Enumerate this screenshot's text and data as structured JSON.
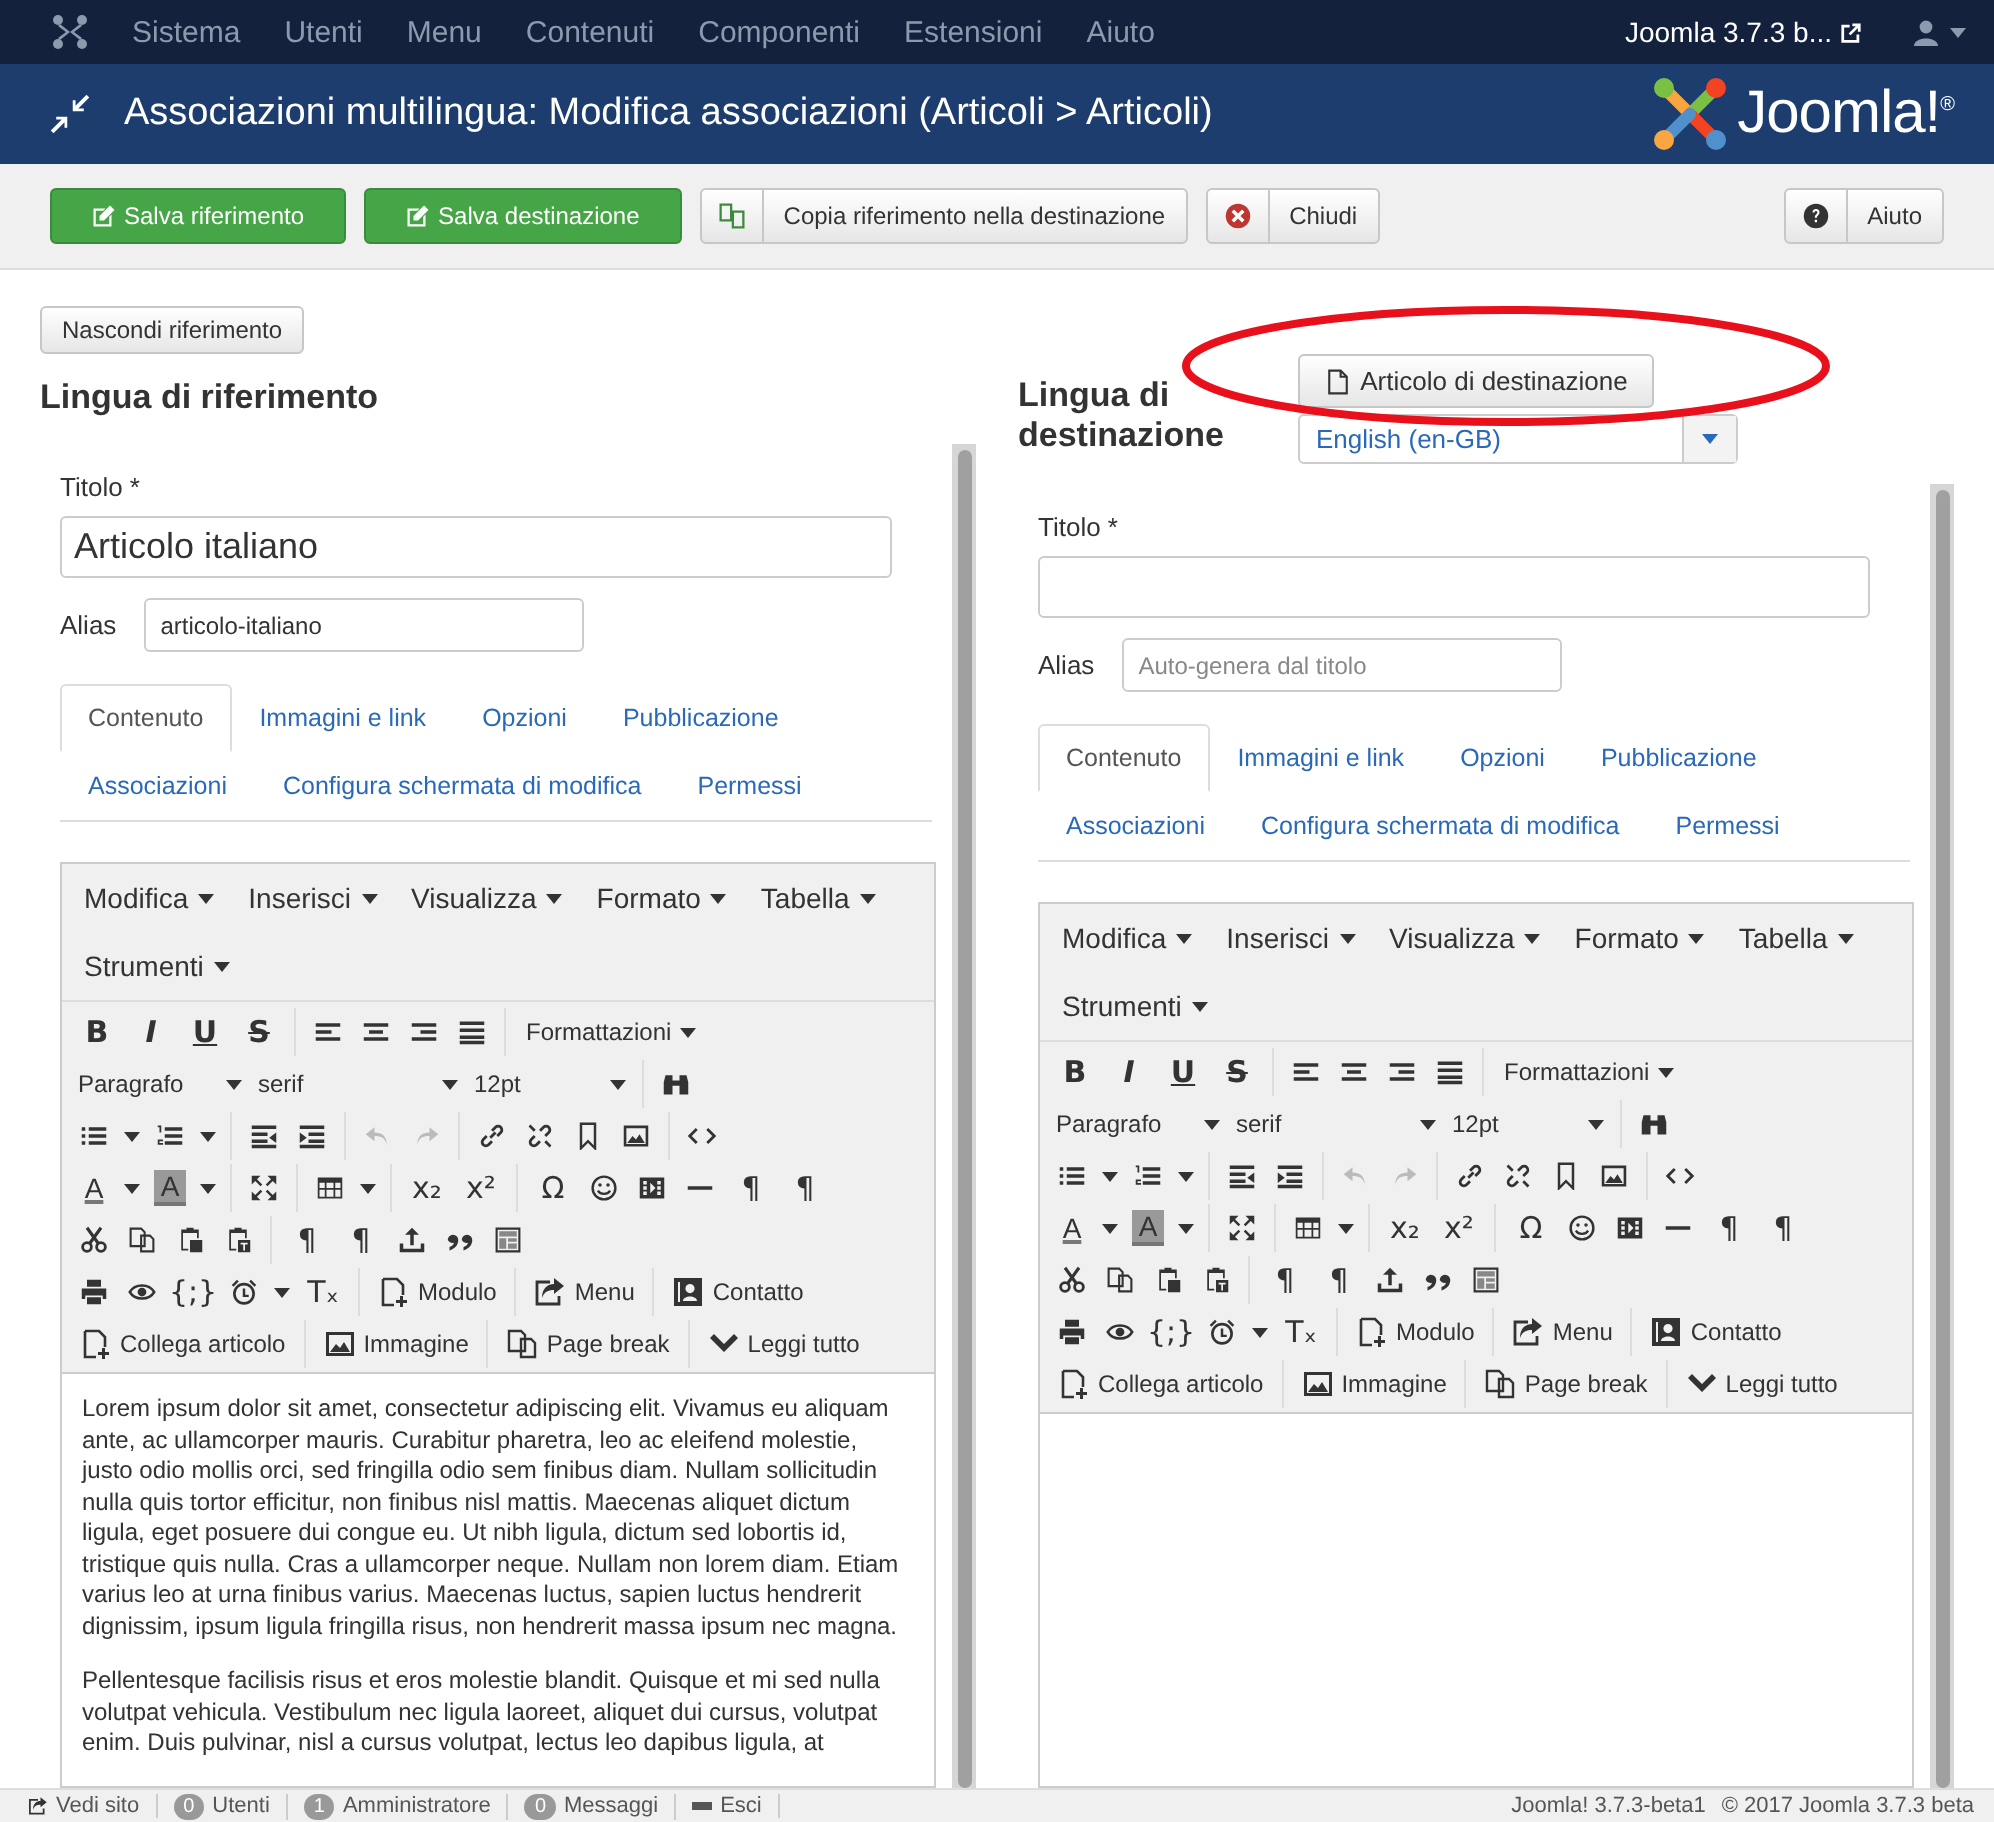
{
  "navbar": {
    "items": [
      "Sistema",
      "Utenti",
      "Menu",
      "Contenuti",
      "Componenti",
      "Estensioni",
      "Aiuto"
    ],
    "site_link": "Joomla 3.7.3 b..."
  },
  "header": {
    "title": "Associazioni multilingua: Modifica associazioni (Articoli > Articoli)",
    "logo_text": "Joomla!$^{®}$"
  },
  "toolbar": {
    "buttons": [
      {
        "label": "Salva riferimento",
        "kind": "success"
      },
      {
        "label": "Salva destinazione",
        "kind": "success"
      },
      {
        "label": "Copia riferimento nella destinazione",
        "kind": "default"
      },
      {
        "label": "Chiudi",
        "kind": "default"
      }
    ],
    "help": "Aiuto"
  },
  "hide_button": "Nascondi riferimento",
  "reference": {
    "heading": "Lingua di riferimento",
    "title_label": "Titolo *",
    "title_value": "Articolo italiano",
    "alias_label": "Alias",
    "alias_value": "articolo-italiano",
    "tabs": [
      {
        "label": "Contenuto",
        "selected": true
      },
      {
        "label": "Immagini e link",
        "selected": false
      },
      {
        "label": "Opzioni",
        "selected": false
      },
      {
        "label": "Pubblicazione",
        "selected": false
      },
      {
        "label": "Associazioni",
        "selected": false
      },
      {
        "label": "Configura schermata di modifica",
        "selected": false
      },
      {
        "label": "Permessi",
        "selected": false
      }
    ],
    "editor": {
      "menus": [
        "Modifica",
        "Inserisci",
        "Visualizza",
        "Formato",
        "Tabella",
        "Strumenti"
      ],
      "rows": [
        {
          "items": [
            {
              "kind": "glyph",
              "text": "B"
            },
            {
              "kind": "glyph",
              "text": "I"
            },
            {
              "kind": "glyph",
              "text": "U"
            },
            {
              "kind": "glyph",
              "text": "S"
            },
            {
              "kind": "sep"
            },
            {
              "kind": "icon"
            },
            {
              "kind": "icon"
            },
            {
              "kind": "icon"
            },
            {
              "kind": "icon"
            },
            {
              "kind": "sep"
            },
            {
              "kind": "menu",
              "text": "Formattazioni"
            }
          ]
        },
        {
          "items": [
            {
              "kind": "select",
              "text": "Paragrafo"
            },
            {
              "kind": "select",
              "text": "serif"
            },
            {
              "kind": "select",
              "text": "12pt"
            },
            {
              "kind": "sep"
            },
            {
              "kind": "icon"
            }
          ]
        },
        {
          "items": [
            {
              "kind": "icon"
            },
            {
              "kind": "caret"
            },
            {
              "kind": "icon"
            },
            {
              "kind": "caret"
            },
            {
              "kind": "sep"
            },
            {
              "kind": "icon"
            },
            {
              "kind": "icon"
            },
            {
              "kind": "sep"
            },
            {
              "kind": "icon"
            },
            {
              "kind": "icon"
            },
            {
              "kind": "sep"
            },
            {
              "kind": "icon"
            },
            {
              "kind": "icon"
            },
            {
              "kind": "icon"
            },
            {
              "kind": "icon"
            },
            {
              "kind": "sep"
            },
            {
              "kind": "icon"
            }
          ]
        },
        {
          "items": [
            {
              "kind": "forecolor",
              "text": "A"
            },
            {
              "kind": "caret"
            },
            {
              "kind": "backcolor",
              "text": "A"
            },
            {
              "kind": "caret"
            },
            {
              "kind": "sep"
            },
            {
              "kind": "icon"
            },
            {
              "kind": "sep"
            },
            {
              "kind": "icon"
            },
            {
              "kind": "caret"
            },
            {
              "kind": "sep"
            },
            {
              "kind": "glyph",
              "text": "x₂"
            },
            {
              "kind": "glyph",
              "text": "x²"
            },
            {
              "kind": "sep"
            },
            {
              "kind": "glyph",
              "text": "Ω"
            },
            {
              "kind": "icon"
            },
            {
              "kind": "icon"
            },
            {
              "kind": "icon"
            },
            {
              "kind": "glyph",
              "text": "¶"
            },
            {
              "kind": "glyph",
              "text": "¶"
            }
          ]
        },
        {
          "items": [
            {
              "kind": "icon"
            },
            {
              "kind": "icon"
            },
            {
              "kind": "icon"
            },
            {
              "kind": "icon"
            },
            {
              "kind": "sep"
            },
            {
              "kind": "glyph",
              "text": "¶"
            },
            {
              "kind": "glyph",
              "text": "¶"
            },
            {
              "kind": "icon"
            },
            {
              "kind": "icon"
            },
            {
              "kind": "icon"
            }
          ]
        },
        {
          "items": [
            {
              "kind": "icon"
            },
            {
              "kind": "icon"
            },
            {
              "kind": "glyph",
              "text": "{;}"
            },
            {
              "kind": "icon"
            },
            {
              "kind": "caret"
            },
            {
              "kind": "glyph",
              "text": "Tₓ"
            },
            {
              "kind": "sep"
            },
            {
              "kind": "labeled",
              "text": "Modulo"
            },
            {
              "kind": "sep"
            },
            {
              "kind": "labeled",
              "text": "Menu"
            },
            {
              "kind": "sep"
            },
            {
              "kind": "labeled",
              "text": "Contatto"
            }
          ]
        },
        {
          "items": [
            {
              "kind": "labeled",
              "text": "Collega articolo"
            },
            {
              "kind": "sep"
            },
            {
              "kind": "labeled",
              "text": "Immagine"
            },
            {
              "kind": "sep"
            },
            {
              "kind": "labeled",
              "text": "Page break"
            },
            {
              "kind": "sep"
            },
            {
              "kind": "labeled",
              "text": "Leggi tutto"
            }
          ]
        }
      ],
      "paragraphs": [
        "Lorem ipsum dolor sit amet, consectetur adipiscing elit. Vivamus eu aliquam ante, ac ullamcorper mauris. Curabitur pharetra, leo ac eleifend molestie, justo odio mollis orci, sed fringilla odio sem finibus diam. Nullam sollicitudin nulla quis tortor efficitur, non finibus nisl mattis. Maecenas aliquet dictum ligula, eget posuere dui congue eu. Ut nibh ligula, dictum sed lobortis id, tristique quis nulla. Cras a ullamcorper neque. Nullam non lorem diam. Etiam varius leo at urna finibus varius. Maecenas luctus, sapien luctus hendrerit dignissim, ipsum ligula fringilla risus, non hendrerit massa ipsum nec magna.",
        "Pellentesque facilisis risus et eros molestie blandit. Quisque et mi sed nulla volutpat vehicula. Vestibulum nec ligula laoreet, aliquet dui cursus, volutpat enim. Duis pulvinar, nisl a cursus volutpat, lectus leo dapibus ligula, at"
      ]
    }
  },
  "target": {
    "heading": "Lingua di destinazione",
    "article_button": "Articolo di destinazione",
    "language_select": "English (en-GB)",
    "title_label": "Titolo *",
    "alias_label": "Alias",
    "alias_placeholder": "Auto-genera dal titolo",
    "tabs": [
      {
        "label": "Contenuto",
        "selected": true
      },
      {
        "label": "Immagini e link",
        "selected": false
      },
      {
        "label": "Opzioni",
        "selected": false
      },
      {
        "label": "Pubblicazione",
        "selected": false
      },
      {
        "label": "Associazioni",
        "selected": false
      },
      {
        "label": "Configura schermata di modifica",
        "selected": false
      },
      {
        "label": "Permessi",
        "selected": false
      }
    ],
    "editor": {
      "menus": [
        "Modifica",
        "Inserisci",
        "Visualizza",
        "Formato",
        "Tabella",
        "Strumenti"
      ],
      "rows": [
        {
          "items": [
            {
              "kind": "glyph",
              "text": "B"
            },
            {
              "kind": "glyph",
              "text": "I"
            },
            {
              "kind": "glyph",
              "text": "U"
            },
            {
              "kind": "glyph",
              "text": "S"
            },
            {
              "kind": "sep"
            },
            {
              "kind": "icon"
            },
            {
              "kind": "icon"
            },
            {
              "kind": "icon"
            },
            {
              "kind": "icon"
            },
            {
              "kind": "sep"
            },
            {
              "kind": "menu",
              "text": "Formattazioni"
            }
          ]
        },
        {
          "items": [
            {
              "kind": "select",
              "text": "Paragrafo"
            },
            {
              "kind": "select",
              "text": "serif"
            },
            {
              "kind": "select",
              "text": "12pt"
            },
            {
              "kind": "sep"
            },
            {
              "kind": "icon"
            }
          ]
        },
        {
          "items": [
            {
              "kind": "icon"
            },
            {
              "kind": "caret"
            },
            {
              "kind": "icon"
            },
            {
              "kind": "caret"
            },
            {
              "kind": "sep"
            },
            {
              "kind": "icon"
            },
            {
              "kind": "icon"
            },
            {
              "kind": "sep"
            },
            {
              "kind": "icon"
            },
            {
              "kind": "icon"
            },
            {
              "kind": "sep"
            },
            {
              "kind": "icon"
            },
            {
              "kind": "icon"
            },
            {
              "kind": "icon"
            },
            {
              "kind": "icon"
            },
            {
              "kind": "sep"
            },
            {
              "kind": "icon"
            }
          ]
        },
        {
          "items": [
            {
              "kind": "forecolor",
              "text": "A"
            },
            {
              "kind": "caret"
            },
            {
              "kind": "backcolor",
              "text": "A"
            },
            {
              "kind": "caret"
            },
            {
              "kind": "sep"
            },
            {
              "kind": "icon"
            },
            {
              "kind": "sep"
            },
            {
              "kind": "icon"
            },
            {
              "kind": "caret"
            },
            {
              "kind": "sep"
            },
            {
              "kind": "glyph",
              "text": "x₂"
            },
            {
              "kind": "glyph",
              "text": "x²"
            },
            {
              "kind": "sep"
            },
            {
              "kind": "glyph",
              "text": "Ω"
            },
            {
              "kind": "icon"
            },
            {
              "kind": "icon"
            },
            {
              "kind": "icon"
            },
            {
              "kind": "glyph",
              "text": "¶"
            },
            {
              "kind": "glyph",
              "text": "¶"
            }
          ]
        },
        {
          "items": [
            {
              "kind": "icon"
            },
            {
              "kind": "icon"
            },
            {
              "kind": "icon"
            },
            {
              "kind": "icon"
            },
            {
              "kind": "sep"
            },
            {
              "kind": "glyph",
              "text": "¶"
            },
            {
              "kind": "glyph",
              "text": "¶"
            },
            {
              "kind": "icon"
            },
            {
              "kind": "icon"
            },
            {
              "kind": "icon"
            }
          ]
        },
        {
          "items": [
            {
              "kind": "icon"
            },
            {
              "kind": "icon"
            },
            {
              "kind": "glyph",
              "text": "{;}"
            },
            {
              "kind": "icon"
            },
            {
              "kind": "caret"
            },
            {
              "kind": "glyph",
              "text": "Tₓ"
            },
            {
              "kind": "sep"
            },
            {
              "kind": "labeled",
              "text": "Modulo"
            },
            {
              "kind": "sep"
            },
            {
              "kind": "labeled",
              "text": "Menu"
            },
            {
              "kind": "sep"
            },
            {
              "kind": "labeled",
              "text": "Contatto"
            }
          ]
        },
        {
          "items": [
            {
              "kind": "labeled",
              "text": "Collega articolo"
            },
            {
              "kind": "sep"
            },
            {
              "kind": "labeled",
              "text": "Immagine"
            },
            {
              "kind": "sep"
            },
            {
              "kind": "labeled",
              "text": "Page break"
            },
            {
              "kind": "sep"
            },
            {
              "kind": "labeled",
              "text": "Leggi tutto"
            }
          ]
        }
      ]
    }
  },
  "status_bar": {
    "items": [
      {
        "kind": "link",
        "label": "Vedi sito"
      },
      {
        "kind": "count",
        "count": "0",
        "label": "Utenti"
      },
      {
        "kind": "count",
        "count": "1",
        "label": "Amministratore"
      },
      {
        "kind": "count",
        "count": "0",
        "label": "Messaggi"
      },
      {
        "kind": "logout",
        "label": "Esci"
      }
    ],
    "version": "Joomla! 3.7.3-beta1",
    "copyright": "© 2017 Joomla 3.7.3 beta"
  }
}
